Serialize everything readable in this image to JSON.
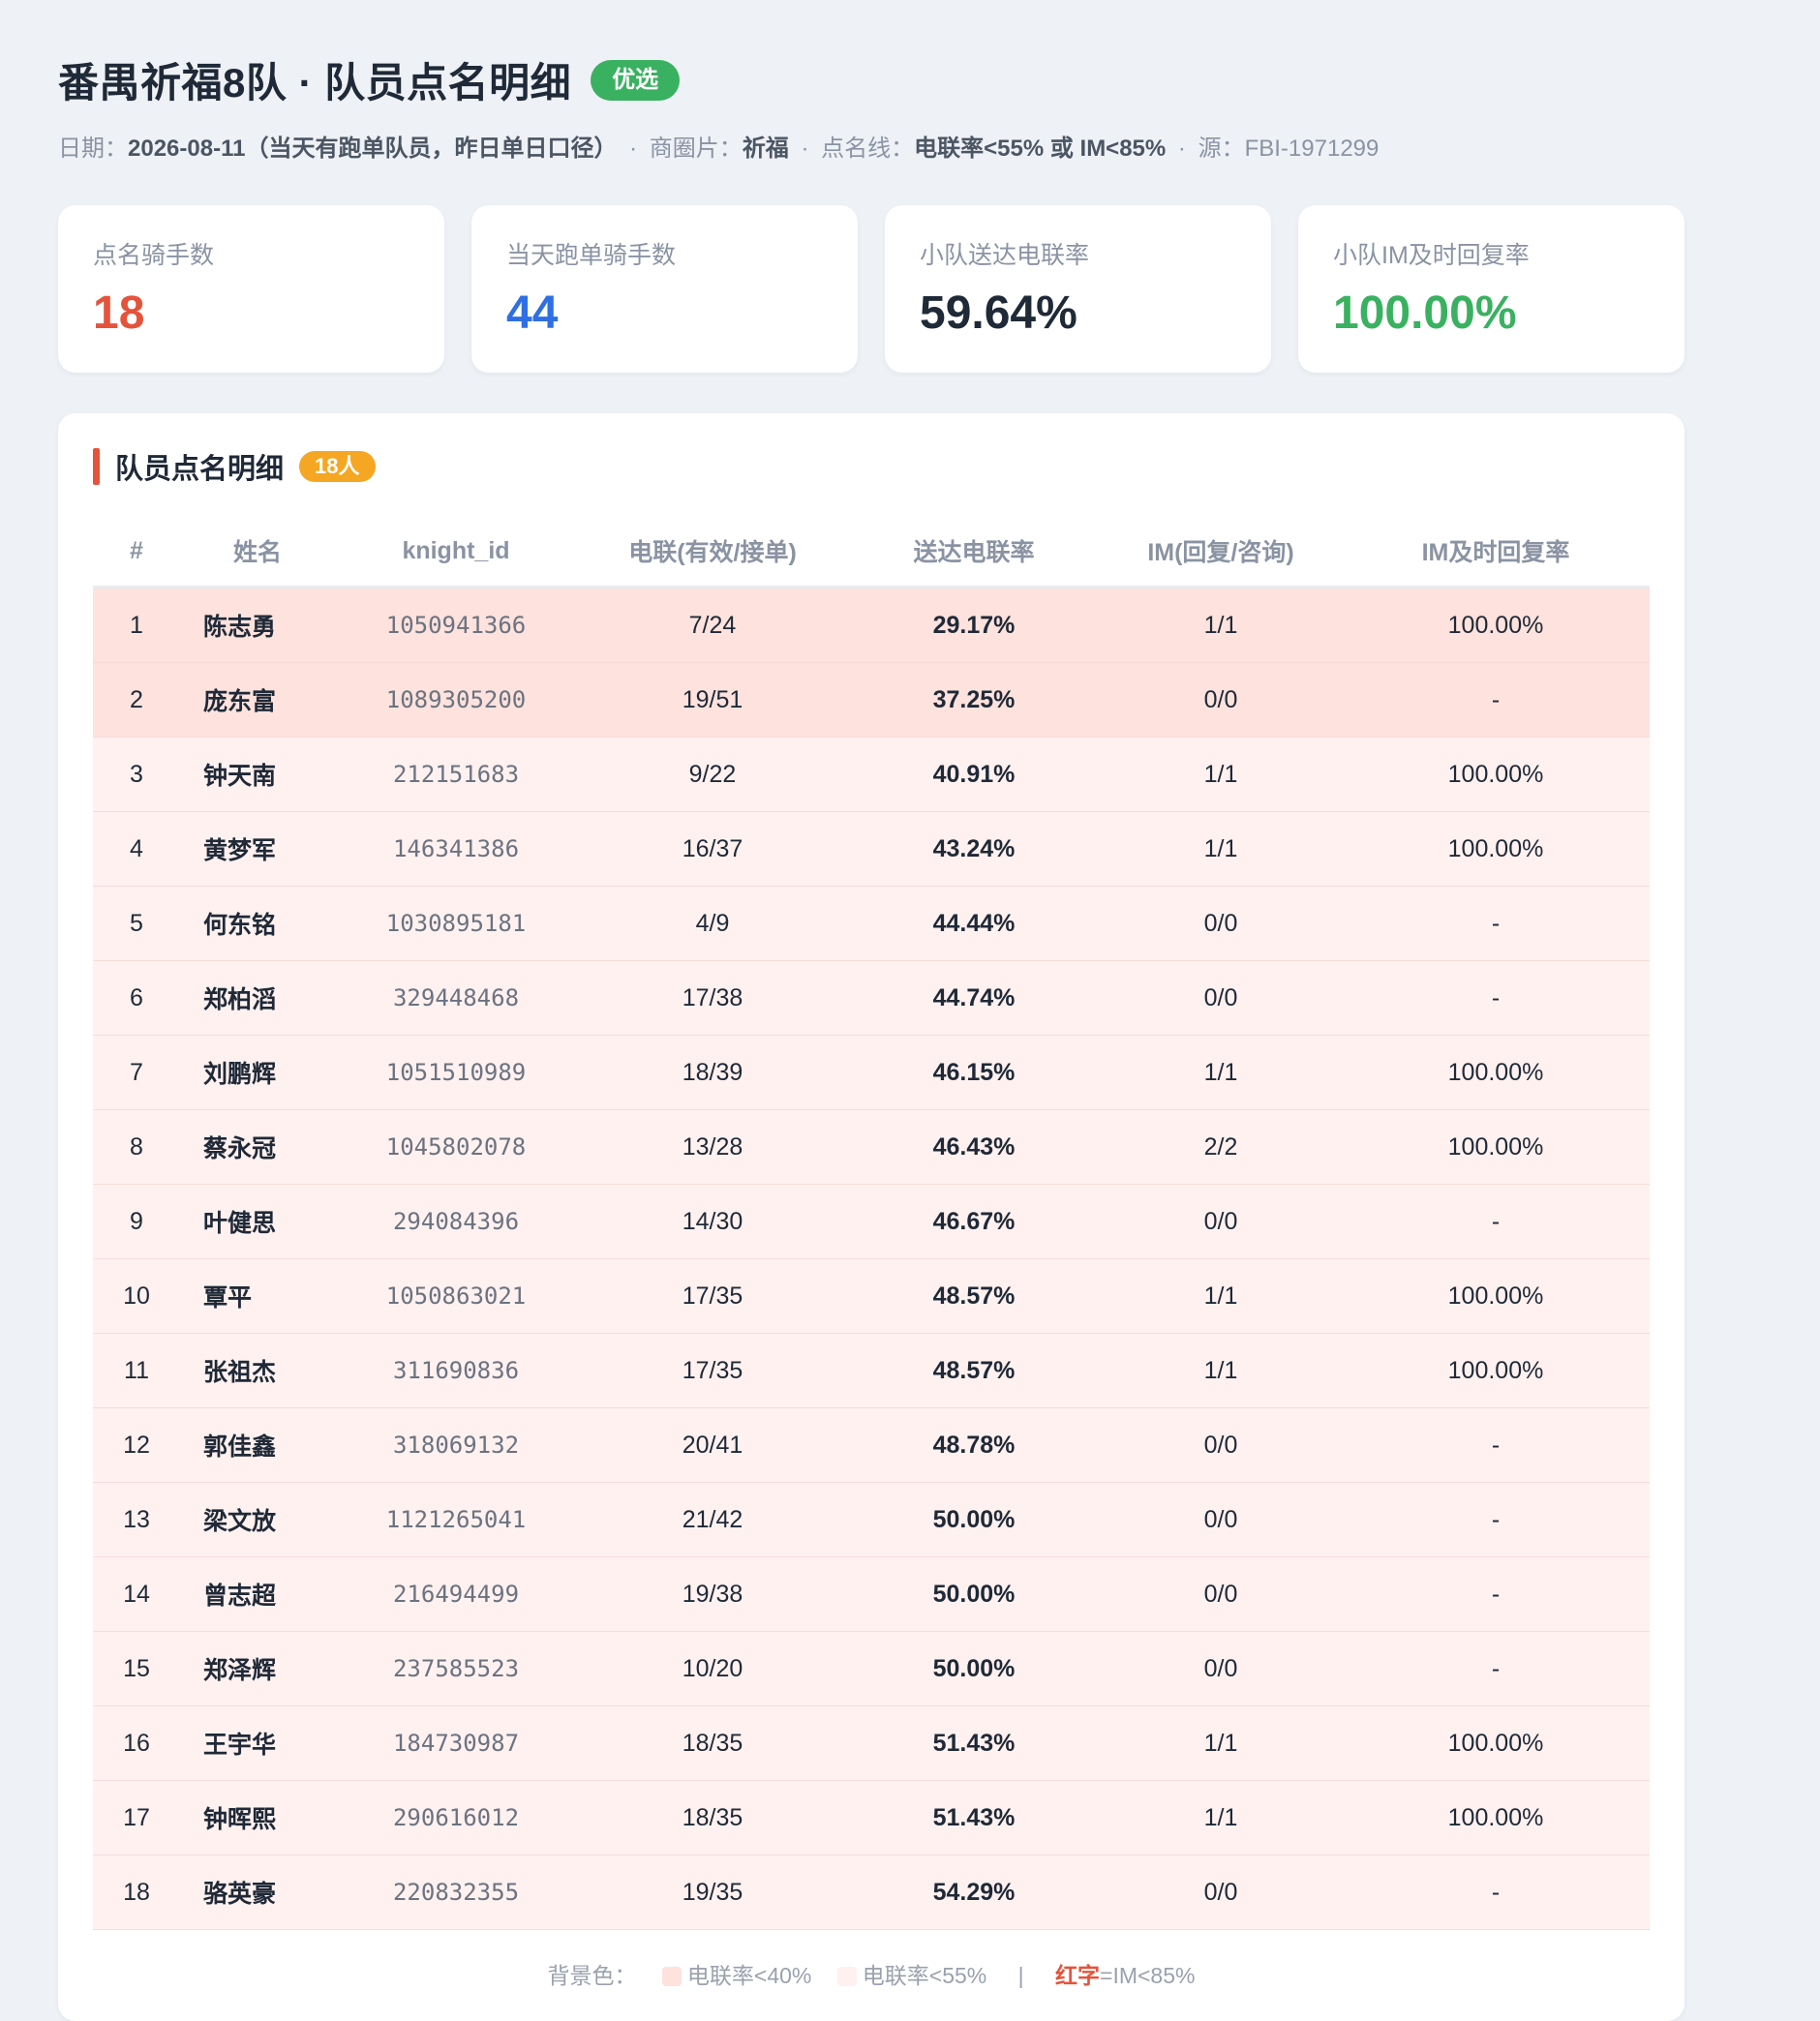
{
  "header": {
    "title": "番禺祈福8队 · 队员点名明细",
    "badge": "优选",
    "subtitle": {
      "date_label": "日期：",
      "date_value": "2026-08-11（当天有跑单队员，昨日单日口径）",
      "area_label": "商圈片：",
      "area_value": "祈福",
      "line_label": "点名线：",
      "line_value": "电联率<55% 或 IM<85%",
      "source_label": "源：",
      "source_value": "FBI-1971299",
      "separator": "·"
    }
  },
  "kpis": [
    {
      "label": "点名骑手数",
      "value": "18",
      "color": "#e5533b"
    },
    {
      "label": "当天跑单骑手数",
      "value": "44",
      "color": "#2f6fe4"
    },
    {
      "label": "小队送达电联率",
      "value": "59.64%",
      "color": "#1f2937"
    },
    {
      "label": "小队IM及时回复率",
      "value": "100.00%",
      "color": "#3ab160"
    }
  ],
  "panel": {
    "title": "队员点名明细",
    "count_badge": "18人",
    "columns": [
      "#",
      "姓名",
      "knight_id",
      "电联(有效/接单)",
      "送达电联率",
      "IM(回复/咨询)",
      "IM及时回复率"
    ],
    "rows": [
      {
        "no": "1",
        "name": "陈志勇",
        "knight_id": "1050941366",
        "call": "7/24",
        "rate": "29.17%",
        "im": "1/1",
        "im_rate": "100.00%",
        "level": "low"
      },
      {
        "no": "2",
        "name": "庞东富",
        "knight_id": "1089305200",
        "call": "19/51",
        "rate": "37.25%",
        "im": "0/0",
        "im_rate": "-",
        "level": "low"
      },
      {
        "no": "3",
        "name": "钟天南",
        "knight_id": "212151683",
        "call": "9/22",
        "rate": "40.91%",
        "im": "1/1",
        "im_rate": "100.00%",
        "level": "mid"
      },
      {
        "no": "4",
        "name": "黄梦军",
        "knight_id": "146341386",
        "call": "16/37",
        "rate": "43.24%",
        "im": "1/1",
        "im_rate": "100.00%",
        "level": "mid"
      },
      {
        "no": "5",
        "name": "何东铭",
        "knight_id": "1030895181",
        "call": "4/9",
        "rate": "44.44%",
        "im": "0/0",
        "im_rate": "-",
        "level": "mid"
      },
      {
        "no": "6",
        "name": "郑柏滔",
        "knight_id": "329448468",
        "call": "17/38",
        "rate": "44.74%",
        "im": "0/0",
        "im_rate": "-",
        "level": "mid"
      },
      {
        "no": "7",
        "name": "刘鹏辉",
        "knight_id": "1051510989",
        "call": "18/39",
        "rate": "46.15%",
        "im": "1/1",
        "im_rate": "100.00%",
        "level": "mid"
      },
      {
        "no": "8",
        "name": "蔡永冠",
        "knight_id": "1045802078",
        "call": "13/28",
        "rate": "46.43%",
        "im": "2/2",
        "im_rate": "100.00%",
        "level": "mid"
      },
      {
        "no": "9",
        "name": "叶健思",
        "knight_id": "294084396",
        "call": "14/30",
        "rate": "46.67%",
        "im": "0/0",
        "im_rate": "-",
        "level": "mid"
      },
      {
        "no": "10",
        "name": "覃平",
        "knight_id": "1050863021",
        "call": "17/35",
        "rate": "48.57%",
        "im": "1/1",
        "im_rate": "100.00%",
        "level": "mid"
      },
      {
        "no": "11",
        "name": "张祖杰",
        "knight_id": "311690836",
        "call": "17/35",
        "rate": "48.57%",
        "im": "1/1",
        "im_rate": "100.00%",
        "level": "mid"
      },
      {
        "no": "12",
        "name": "郭佳鑫",
        "knight_id": "318069132",
        "call": "20/41",
        "rate": "48.78%",
        "im": "0/0",
        "im_rate": "-",
        "level": "mid"
      },
      {
        "no": "13",
        "name": "梁文放",
        "knight_id": "1121265041",
        "call": "21/42",
        "rate": "50.00%",
        "im": "0/0",
        "im_rate": "-",
        "level": "mid"
      },
      {
        "no": "14",
        "name": "曾志超",
        "knight_id": "216494499",
        "call": "19/38",
        "rate": "50.00%",
        "im": "0/0",
        "im_rate": "-",
        "level": "mid"
      },
      {
        "no": "15",
        "name": "郑泽辉",
        "knight_id": "237585523",
        "call": "10/20",
        "rate": "50.00%",
        "im": "0/0",
        "im_rate": "-",
        "level": "mid"
      },
      {
        "no": "16",
        "name": "王宇华",
        "knight_id": "184730987",
        "call": "18/35",
        "rate": "51.43%",
        "im": "1/1",
        "im_rate": "100.00%",
        "level": "mid"
      },
      {
        "no": "17",
        "name": "钟晖熙",
        "knight_id": "290616012",
        "call": "18/35",
        "rate": "51.43%",
        "im": "1/1",
        "im_rate": "100.00%",
        "level": "mid"
      },
      {
        "no": "18",
        "name": "骆英豪",
        "knight_id": "220832355",
        "call": "19/35",
        "rate": "54.29%",
        "im": "0/0",
        "im_rate": "-",
        "level": "mid"
      }
    ],
    "legend": {
      "label": "背景色：",
      "low_label": "电联率<40%",
      "low_color": "#fde2dd",
      "mid_label": "电联率<55%",
      "mid_color": "#fff1ef",
      "pipe": "|",
      "red_text": "红字",
      "red_rule": "=IM<85%",
      "red_color": "#e5533b"
    }
  }
}
